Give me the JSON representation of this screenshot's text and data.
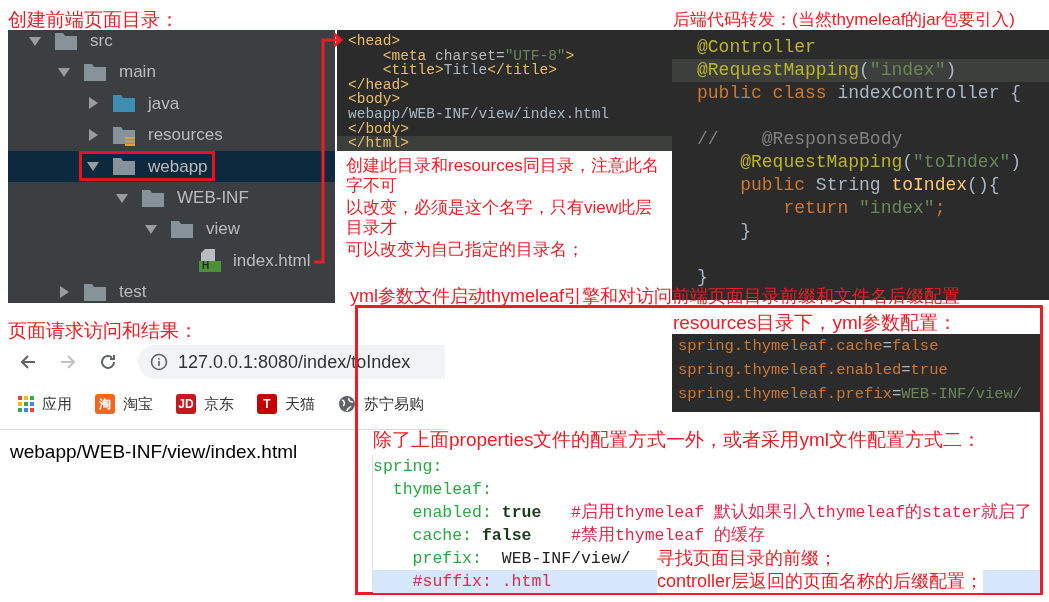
{
  "project_tree": {
    "heading": "创建前端页面目录：",
    "items": [
      {
        "label": "src",
        "kind": "folder",
        "expanded": true,
        "selected": false,
        "outlined": false,
        "children": [
          {
            "label": "main",
            "kind": "folder",
            "expanded": true,
            "selected": false,
            "outlined": false,
            "children": [
              {
                "label": "java",
                "kind": "source-folder",
                "expanded": false,
                "selected": false,
                "outlined": false
              },
              {
                "label": "resources",
                "kind": "resource-folder",
                "expanded": false,
                "selected": false,
                "outlined": false
              },
              {
                "label": "webapp",
                "kind": "folder",
                "expanded": true,
                "selected": true,
                "outlined": true,
                "children": [
                  {
                    "label": "WEB-INF",
                    "kind": "folder",
                    "expanded": true,
                    "selected": false,
                    "outlined": false,
                    "children": [
                      {
                        "label": "view",
                        "kind": "folder",
                        "expanded": true,
                        "selected": false,
                        "outlined": false,
                        "children": [
                          {
                            "label": "index.html",
                            "kind": "html-file",
                            "badge": "H",
                            "selected": false,
                            "outlined": false
                          }
                        ]
                      }
                    ]
                  }
                ]
              }
            ]
          },
          {
            "label": "test",
            "kind": "folder",
            "expanded": false,
            "selected": false,
            "outlined": false
          }
        ]
      }
    ]
  },
  "tree_notes": [
    "创建此目录和resources同目录，注意此名字不可",
    "以改变，必须是这个名字，只有view此层目录才",
    "可以改变为自己指定的目录名；"
  ],
  "html_editor": {
    "lines": [
      {
        "current": false,
        "tokens": [
          {
            "t": "<head>",
            "kind": "tag"
          }
        ]
      },
      {
        "current": false,
        "tokens": [
          {
            "t": "    <meta",
            "kind": "tag"
          },
          {
            "t": " charset=",
            "kind": "attr"
          },
          {
            "t": "\"UTF-8\"",
            "kind": "string"
          },
          {
            "t": ">",
            "kind": "tag"
          }
        ]
      },
      {
        "current": false,
        "tokens": [
          {
            "t": "    <title>",
            "kind": "tag"
          },
          {
            "t": "Title",
            "kind": "plain"
          },
          {
            "t": "</title>",
            "kind": "tag"
          }
        ]
      },
      {
        "current": false,
        "tokens": [
          {
            "t": "</head>",
            "kind": "tag"
          }
        ]
      },
      {
        "current": false,
        "tokens": [
          {
            "t": "<body>",
            "kind": "tag"
          }
        ]
      },
      {
        "current": false,
        "tokens": [
          {
            "t": "webapp/WEB-INF/view/index.html",
            "kind": "plain"
          }
        ]
      },
      {
        "current": false,
        "tokens": [
          {
            "t": "</body>",
            "kind": "tag"
          }
        ]
      },
      {
        "current": true,
        "tokens": [
          {
            "t": "</html>",
            "kind": "tag"
          }
        ]
      }
    ]
  },
  "java_editor": {
    "heading": "后端代码转发：(当然thymeleaf的jar包要引入)",
    "lines": [
      {
        "current": false,
        "tokens": [
          {
            "t": "@Controller",
            "kind": "annotation"
          }
        ]
      },
      {
        "current": true,
        "tokens": [
          {
            "t": "@RequestMapping",
            "kind": "annotation"
          },
          {
            "t": "(",
            "kind": "plain"
          },
          {
            "t": "\"index\"",
            "kind": "string"
          },
          {
            "t": ")",
            "kind": "plain"
          }
        ]
      },
      {
        "current": false,
        "tokens": [
          {
            "t": "public class ",
            "kind": "keyword"
          },
          {
            "t": "indexController {",
            "kind": "plain"
          }
        ]
      },
      {
        "current": false
      },
      {
        "current": false,
        "tokens": [
          {
            "t": "//    @ResponseBody",
            "kind": "comment"
          }
        ]
      },
      {
        "current": false,
        "tokens": [
          {
            "t": "    @RequestMapping",
            "kind": "annotation"
          },
          {
            "t": "(",
            "kind": "plain"
          },
          {
            "t": "\"toIndex\"",
            "kind": "string"
          },
          {
            "t": ")",
            "kind": "plain"
          }
        ]
      },
      {
        "current": false,
        "tokens": [
          {
            "t": "    public ",
            "kind": "keyword"
          },
          {
            "t": "String ",
            "kind": "plain"
          },
          {
            "t": "toIndex",
            "kind": "method"
          },
          {
            "t": "(){",
            "kind": "plain"
          }
        ]
      },
      {
        "current": false,
        "tokens": [
          {
            "t": "        return ",
            "kind": "keyword"
          },
          {
            "t": "\"index\"",
            "kind": "string"
          },
          {
            "t": ";",
            "kind": "keyword"
          }
        ]
      },
      {
        "current": false,
        "tokens": [
          {
            "t": "    }",
            "kind": "plain"
          }
        ]
      },
      {
        "current": false
      },
      {
        "current": false,
        "tokens": [
          {
            "t": "}",
            "kind": "plain"
          }
        ]
      }
    ]
  },
  "yml_note": "yml参数文件启动thymeleaf引擎和对访问前端页面目录前缀和文件名后缀配置",
  "browser": {
    "heading": "页面请求访问和结果：",
    "url": "127.0.0.1:8080/index/toIndex",
    "bookmarks": [
      {
        "label": "应用",
        "kind": "apps"
      },
      {
        "label": "淘宝",
        "kind": "badge",
        "icon_text": "淘",
        "color": "#f2661f"
      },
      {
        "label": "京东",
        "kind": "badge",
        "icon_text": "JD",
        "color": "#c81623"
      },
      {
        "label": "天猫",
        "kind": "badge",
        "icon_text": "T",
        "color": "#c40000"
      },
      {
        "label": "苏宁易购",
        "kind": "globe"
      }
    ],
    "page_text": "webapp/WEB-INF/view/index.html"
  },
  "config": {
    "properties_heading": "resources目录下，yml参数配置：",
    "properties_lines": [
      {
        "tokens": [
          {
            "t": "spring.thymeleaf.cache",
            "kind": "key"
          },
          {
            "t": "=",
            "kind": "plain"
          },
          {
            "t": "false",
            "kind": "key"
          }
        ]
      },
      {
        "tokens": [
          {
            "t": "spring.thymeleaf.enabled",
            "kind": "key"
          },
          {
            "t": "=",
            "kind": "plain"
          },
          {
            "t": "true",
            "kind": "key"
          }
        ]
      },
      {
        "tokens": [
          {
            "t": "spring.thymeleaf.prefix",
            "kind": "key"
          },
          {
            "t": "=",
            "kind": "plain"
          },
          {
            "t": "WEB-INF/view/",
            "kind": "string"
          }
        ]
      }
    ],
    "yml_heading": "除了上面properties文件的配置方式一外，或者采用yml文件配置方式二：",
    "yml_lines": [
      {
        "current": false,
        "tokens": [
          {
            "t": "spring:",
            "kind": "key"
          }
        ]
      },
      {
        "current": false,
        "tokens": [
          {
            "t": "  thymeleaf:",
            "kind": "key"
          }
        ]
      },
      {
        "current": false,
        "tokens": [
          {
            "t": "    enabled: ",
            "kind": "key"
          },
          {
            "t": "true",
            "kind": "value"
          },
          {
            "t": "   #启用thymeleaf 默认如果引入thymeleaf的stater就启了",
            "kind": "comment"
          }
        ]
      },
      {
        "current": false,
        "tokens": [
          {
            "t": "    cache: ",
            "kind": "key"
          },
          {
            "t": "false",
            "kind": "value"
          },
          {
            "t": "    #禁用thymeleaf 的缓存",
            "kind": "comment"
          }
        ]
      },
      {
        "current": false,
        "tokens": [
          {
            "t": "    prefix:  ",
            "kind": "key"
          },
          {
            "t": "WEB-INF/view/",
            "kind": "plain"
          }
        ],
        "note": "寻找页面目录的前缀；"
      },
      {
        "current": true,
        "tokens": [
          {
            "t": "    #suffix: .html",
            "kind": "comment"
          }
        ],
        "note": "controller层返回的页面名称的后缀配置；"
      }
    ]
  }
}
